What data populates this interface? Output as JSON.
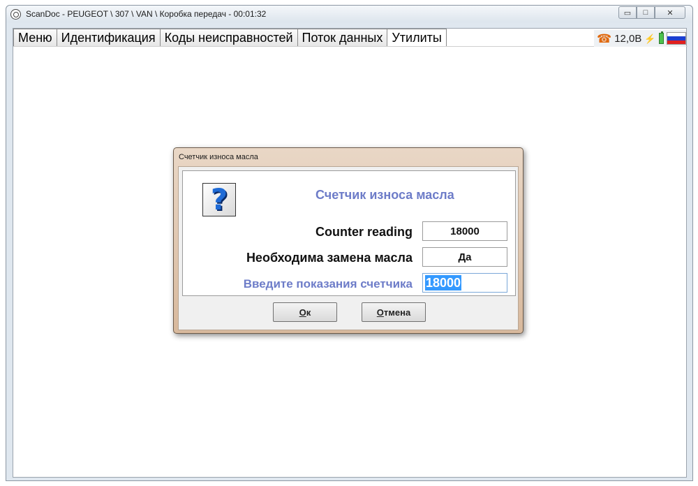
{
  "window": {
    "title": "ScanDoc - PEUGEOT \\ 307 \\ VAN \\ Коробка передач - 00:01:32",
    "controls": {
      "minimize": "▭",
      "maximize": "□",
      "close": "✕"
    }
  },
  "tabs": [
    {
      "label": "Меню"
    },
    {
      "label": "Идентификация"
    },
    {
      "label": "Коды неисправностей"
    },
    {
      "label": "Поток данных"
    },
    {
      "label": "Утилиты"
    }
  ],
  "status": {
    "voltage": "12,0В",
    "icons": [
      "phone-icon",
      "plug-icon",
      "battery-icon",
      "russia-flag-icon"
    ],
    "flag_colors": [
      "#ffffff",
      "#1c3fd1",
      "#e0201f"
    ]
  },
  "dialog": {
    "title": "Счетчик износа масла",
    "heading": "Счетчик износа масла",
    "rows": [
      {
        "label": "Counter reading",
        "value": "18000"
      },
      {
        "label": "Необходима замена масла",
        "value": "Да"
      }
    ],
    "input": {
      "label": "Введите показания счетчика",
      "value": "18000"
    },
    "ok": {
      "accel": "О",
      "rest": "к"
    },
    "cancel": {
      "accel": "О",
      "rest": "тмена"
    }
  },
  "colors": {
    "accent_label": "#6d7cc8",
    "selection": "#3399ff"
  }
}
